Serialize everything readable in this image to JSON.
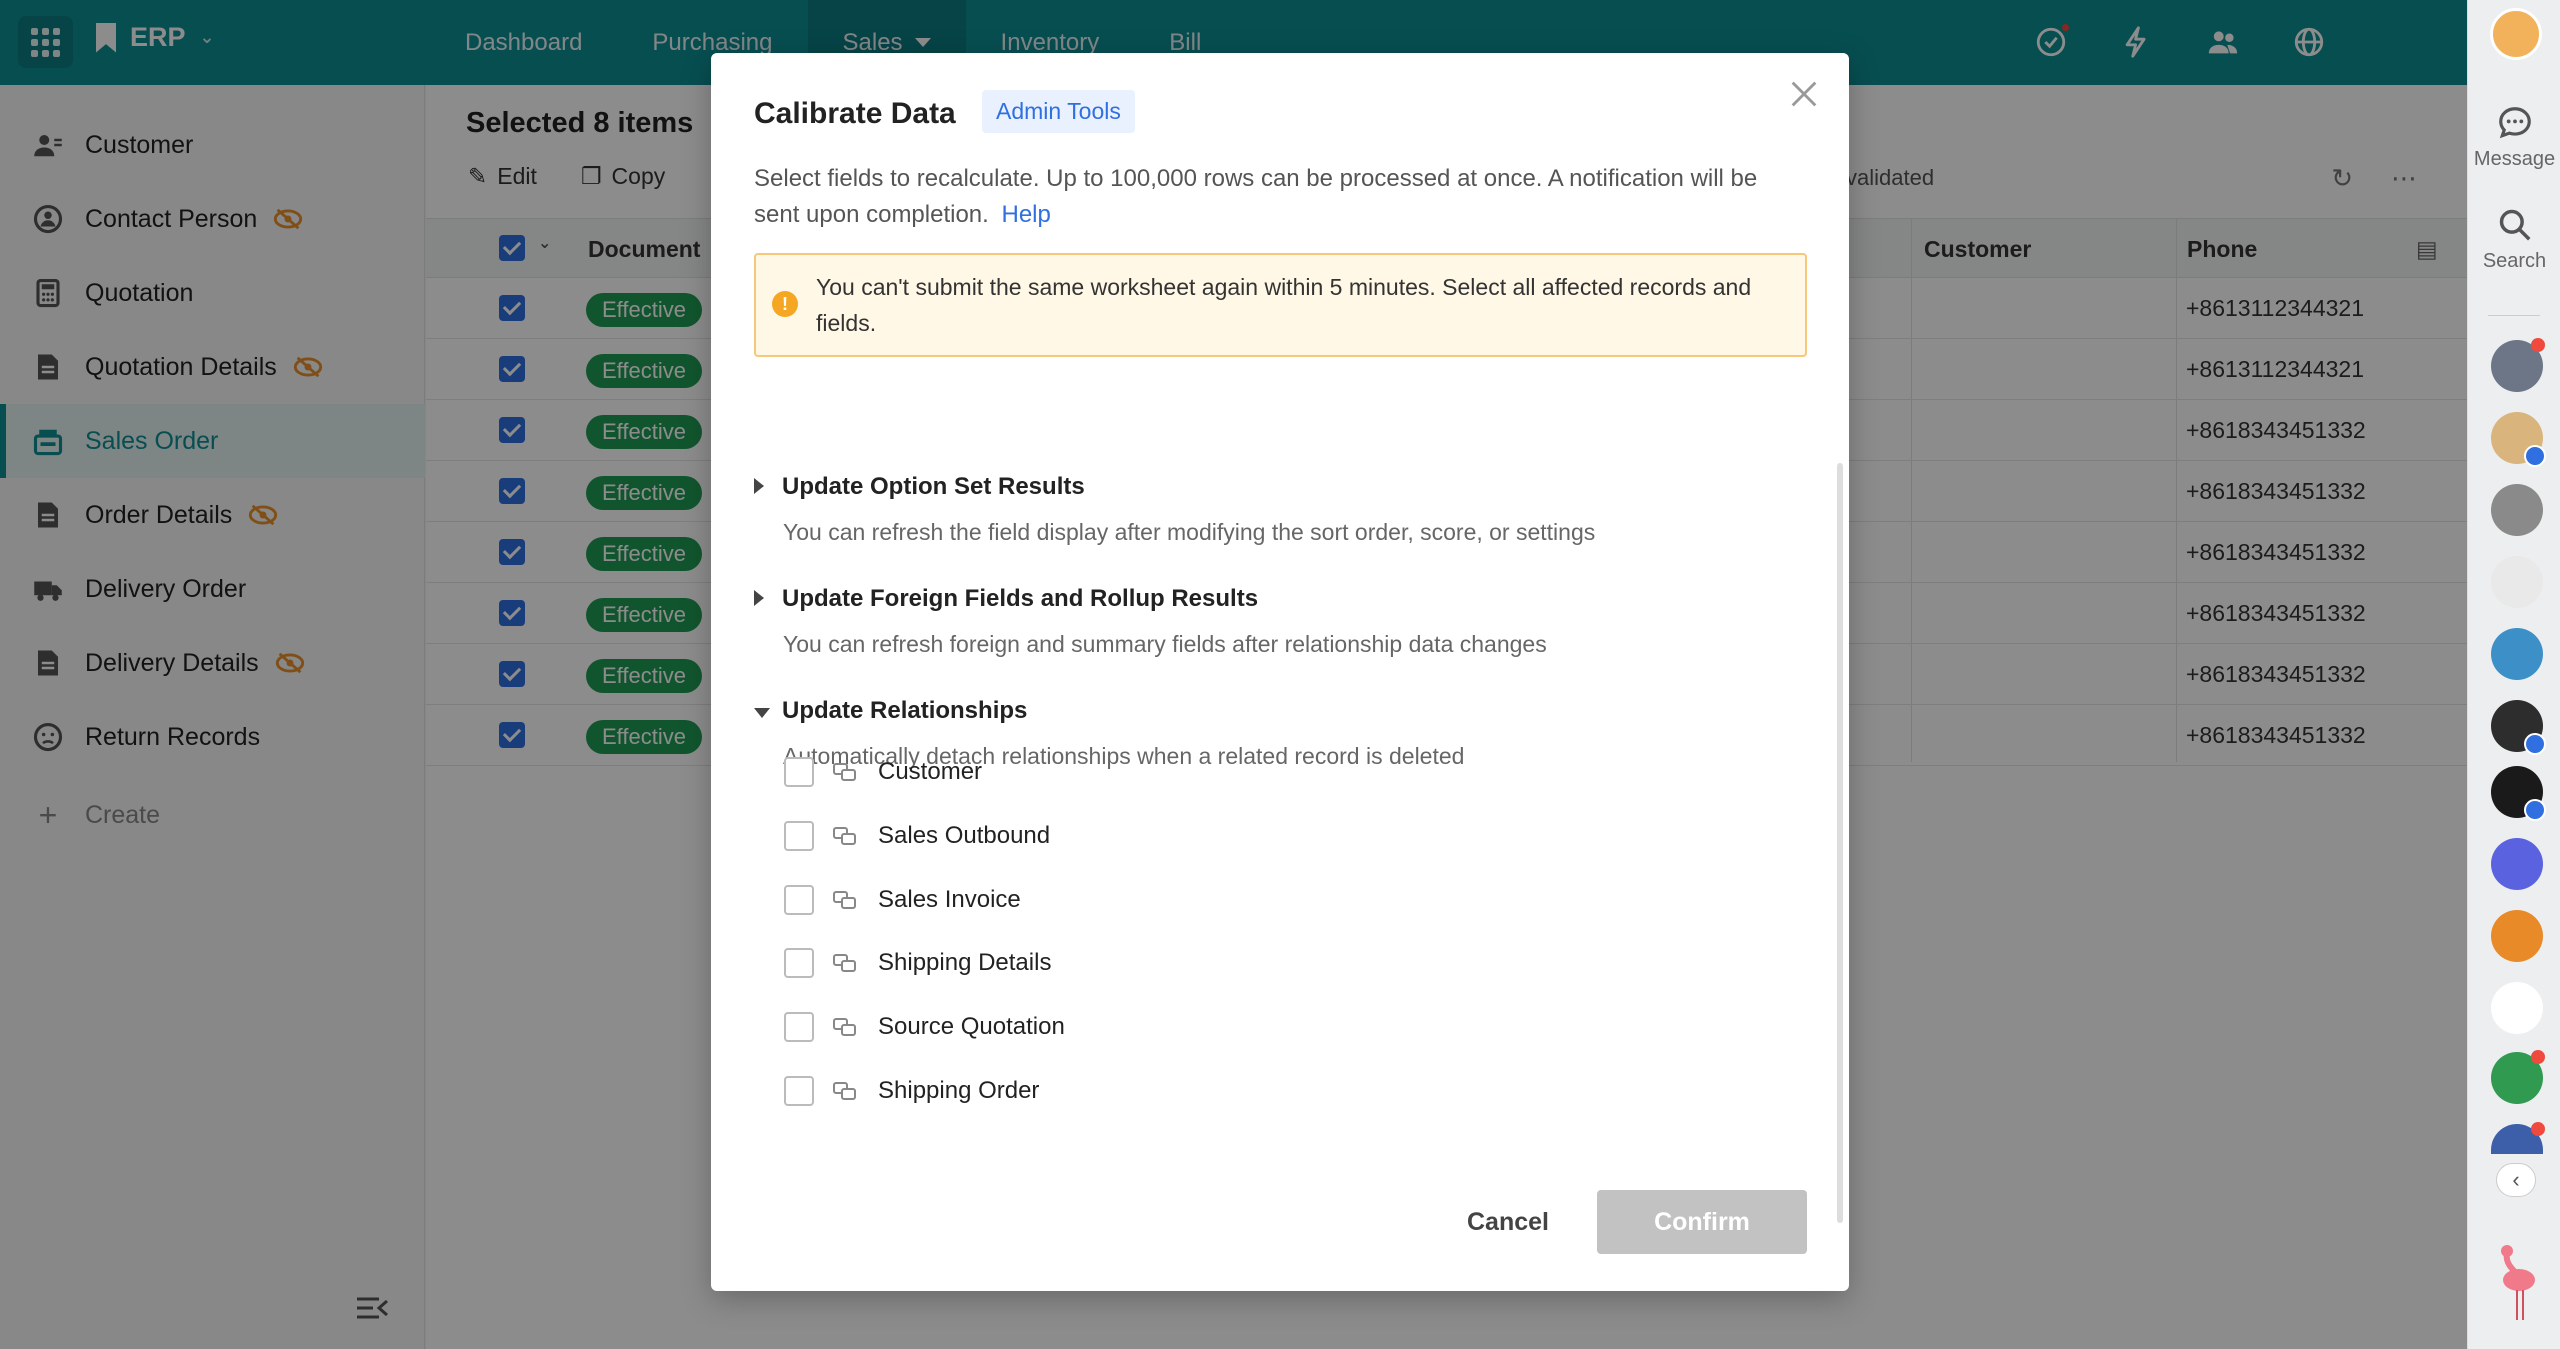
{
  "app": {
    "name": "ERP"
  },
  "nav": {
    "tabs": [
      {
        "label": "Dashboard"
      },
      {
        "label": "Purchasing"
      },
      {
        "label": "Sales"
      },
      {
        "label": "Inventory"
      },
      {
        "label": "Bill"
      }
    ],
    "active_tab": "Sales"
  },
  "sidebar": {
    "items": [
      {
        "label": "Customer",
        "icon": "customer-icon"
      },
      {
        "label": "Contact Person",
        "icon": "contact-icon",
        "hidden": true
      },
      {
        "label": "Quotation",
        "icon": "calculator-icon"
      },
      {
        "label": "Quotation Details",
        "icon": "document-icon",
        "hidden": true
      },
      {
        "label": "Sales Order",
        "icon": "register-icon",
        "active": true
      },
      {
        "label": "Order Details",
        "icon": "document-icon",
        "hidden": true
      },
      {
        "label": "Delivery Order",
        "icon": "truck-icon"
      },
      {
        "label": "Delivery Details",
        "icon": "document-icon",
        "hidden": true
      },
      {
        "label": "Return Records",
        "icon": "sad-face-icon"
      }
    ],
    "create_label": "Create"
  },
  "main": {
    "selection_title": "Selected 8 items",
    "toolbar": {
      "edit_label": "Edit",
      "copy_label": "Copy",
      "validated_label": "validated"
    },
    "columns": {
      "document": "Document",
      "customer": "Customer",
      "phone": "Phone"
    },
    "rows": [
      {
        "status": "Effective",
        "phone": "+8613112344321"
      },
      {
        "status": "Effective",
        "phone": "+8613112344321"
      },
      {
        "status": "Effective",
        "phone": "+8618343451332"
      },
      {
        "status": "Effective",
        "phone": "+8618343451332"
      },
      {
        "status": "Effective",
        "phone": "+8618343451332"
      },
      {
        "status": "Effective",
        "phone": "+8618343451332"
      },
      {
        "status": "Effective",
        "phone": "+8618343451332"
      },
      {
        "status": "Effective",
        "phone": "+8618343451332"
      }
    ]
  },
  "rail": {
    "message_label": "Message",
    "search_label": "Search"
  },
  "modal": {
    "title": "Calibrate Data",
    "tag": "Admin Tools",
    "description": "Select fields to recalculate. Up to 100,000 rows can be processed at once. A notification will be sent upon completion.",
    "help_label": "Help",
    "warning": "You can't submit the same worksheet again within 5 minutes. Select all affected records and fields.",
    "sections": [
      {
        "title": "Update Option Set Results",
        "subtitle": "You can refresh the field display after modifying the sort order, score, or settings",
        "expanded": false
      },
      {
        "title": "Update Foreign Fields and Rollup Results",
        "subtitle": "You can refresh foreign and summary fields after relationship data changes",
        "expanded": false
      },
      {
        "title": "Update Relationships",
        "subtitle": "Automatically detach relationships when a related record is deleted",
        "expanded": true
      }
    ],
    "relationships": [
      {
        "label": "Customer",
        "checked": false
      },
      {
        "label": "Sales Outbound",
        "checked": false
      },
      {
        "label": "Sales Invoice",
        "checked": false
      },
      {
        "label": "Shipping Details",
        "checked": false
      },
      {
        "label": "Source Quotation",
        "checked": false
      },
      {
        "label": "Shipping Order",
        "checked": false
      }
    ],
    "cancel_label": "Cancel",
    "confirm_label": "Confirm"
  },
  "colors": {
    "brand": "#0e8e94",
    "accent": "#2f6fe0",
    "status_green": "#1f9b55",
    "warning_bg": "#fff8e6"
  }
}
